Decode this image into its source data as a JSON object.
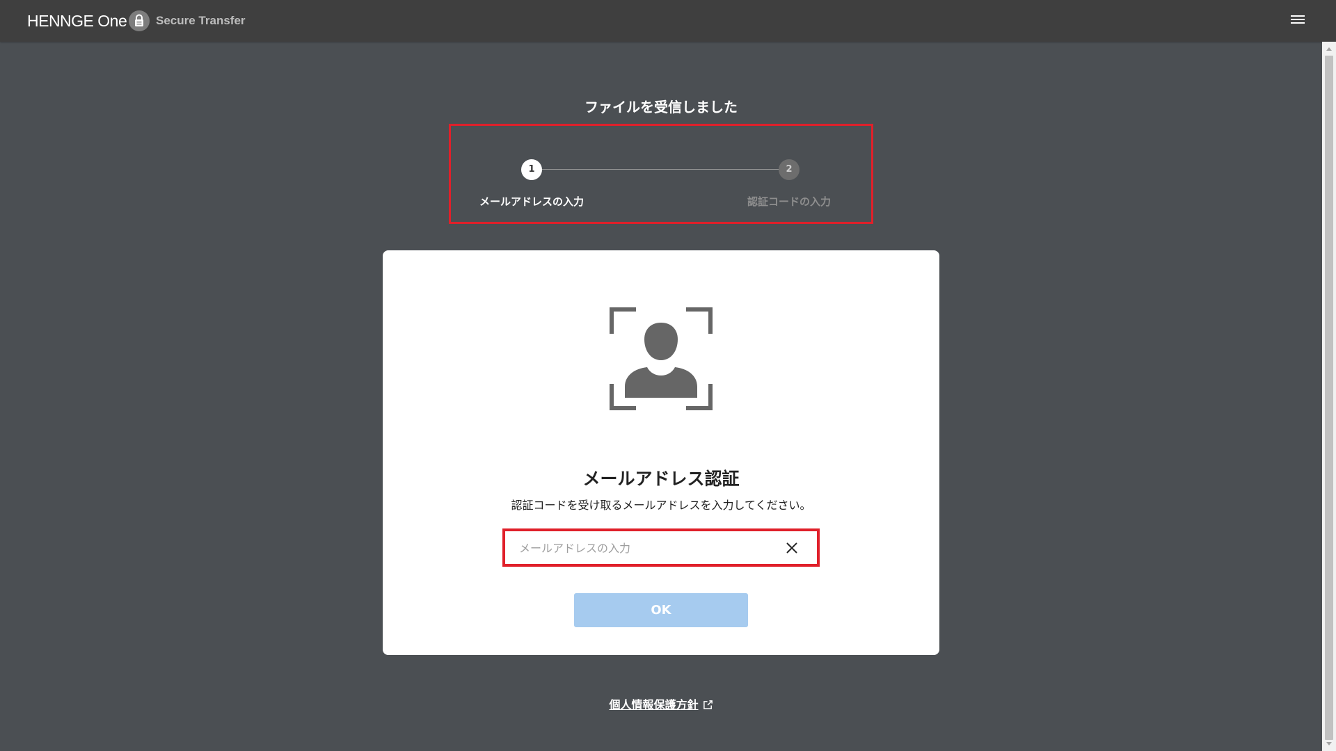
{
  "header": {
    "brand": "HENNGE One",
    "product": "Secure Transfer",
    "menu_icon": "hamburger-menu-icon",
    "lock_icon": "lock-icon"
  },
  "page": {
    "title": "ファイルを受信しました"
  },
  "stepper": {
    "steps": [
      {
        "number": "1",
        "label": "メールアドレスの入力",
        "state": "active"
      },
      {
        "number": "2",
        "label": "認証コードの入力",
        "state": "inactive"
      }
    ]
  },
  "card": {
    "icon": "face-scan-icon",
    "title": "メールアドレス認証",
    "description": "認証コードを受け取るメールアドレスを入力してください。",
    "email_input": {
      "value": "",
      "placeholder": "メールアドレスの入力"
    },
    "clear_icon": "close-icon",
    "ok_label": "OK"
  },
  "footer": {
    "privacy_link": "個人情報保護方針",
    "external_icon": "external-link-icon"
  },
  "colors": {
    "background": "#4b4f53",
    "topbar": "#3f3f3f",
    "highlight_border": "#e0202a",
    "ok_button": "#a6cbef",
    "card": "#ffffff"
  }
}
